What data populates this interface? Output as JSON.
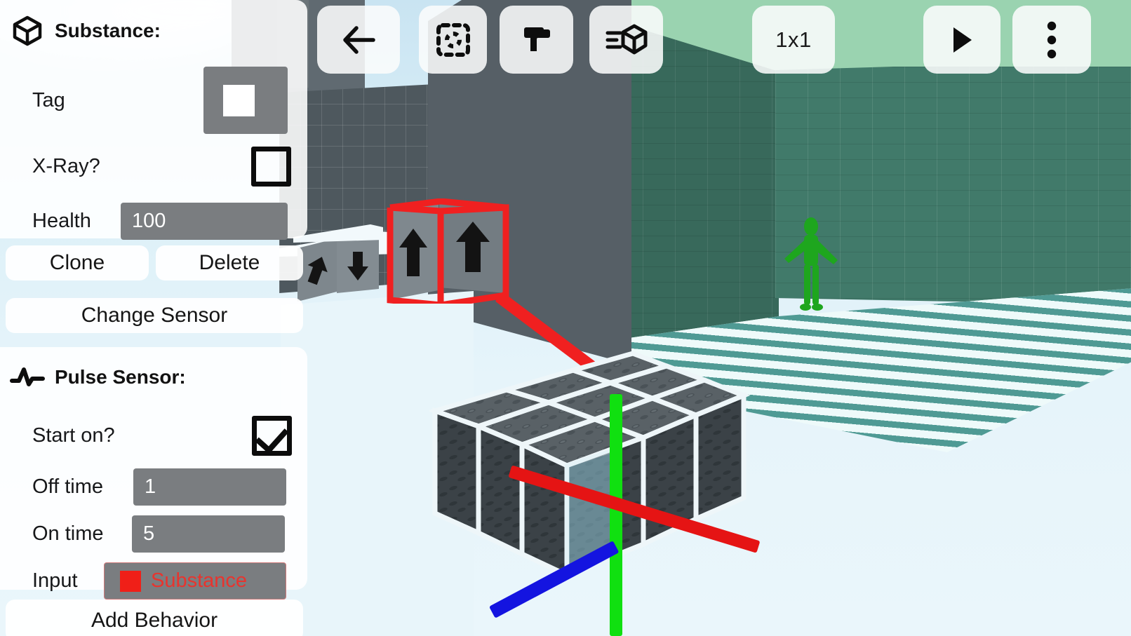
{
  "app": {
    "viewport_name": "3d-block-editor-viewport"
  },
  "toolbar": {
    "buttons": [
      {
        "name": "back-button",
        "icon": "arrow-left-icon",
        "label": ""
      },
      {
        "name": "select-button",
        "icon": "marquee-select-icon",
        "label": ""
      },
      {
        "name": "paint-button",
        "icon": "paint-roller-icon",
        "label": ""
      },
      {
        "name": "substance-button",
        "icon": "cube-list-icon",
        "label": ""
      },
      {
        "name": "brush-size-button",
        "icon": "",
        "label": "1x1"
      },
      {
        "name": "play-button",
        "icon": "play-triangle-icon",
        "label": ""
      },
      {
        "name": "overflow-menu-button",
        "icon": "three-dots-vertical-icon",
        "label": ""
      }
    ]
  },
  "substance_panel": {
    "icon": "cube-outline-icon",
    "title": "Substance:",
    "rows": [
      {
        "label": "Tag",
        "type": "color-swatch",
        "value": "",
        "swatch": "#ffffff"
      },
      {
        "label": "X-Ray?",
        "type": "checkbox",
        "value": "",
        "checked": false
      },
      {
        "label": "Health",
        "type": "text",
        "value": "100"
      }
    ],
    "actions": {
      "clone_label": "Clone",
      "delete_label": "Delete",
      "change_sensor_label": "Change Sensor"
    }
  },
  "pulse_sensor_panel": {
    "icon": "pulse-wave-icon",
    "title": "Pulse Sensor:",
    "rows": [
      {
        "label": "Start on?",
        "type": "checkbox",
        "value": "",
        "checked": true
      },
      {
        "label": "Off time",
        "type": "text",
        "value": "1"
      },
      {
        "label": "On time",
        "type": "text",
        "value": "5"
      },
      {
        "label": "Input",
        "type": "entity",
        "value": "Substance",
        "swatch": "#f01f18"
      }
    ]
  },
  "add_behavior_panel": {
    "label": "Add Behavior"
  },
  "colors": {
    "panel_bg": "#ffffff",
    "field_bg": "#7a7d80",
    "accent_red": "#f01f18",
    "selection_red": "#f02020",
    "axis_x": "#e51414",
    "axis_y": "#10e010",
    "axis_z": "#1414e0",
    "sky": "#dff0f8",
    "green_wall": "#417a6a",
    "grey_wall": "#565f66",
    "player": "#1ea01e"
  }
}
